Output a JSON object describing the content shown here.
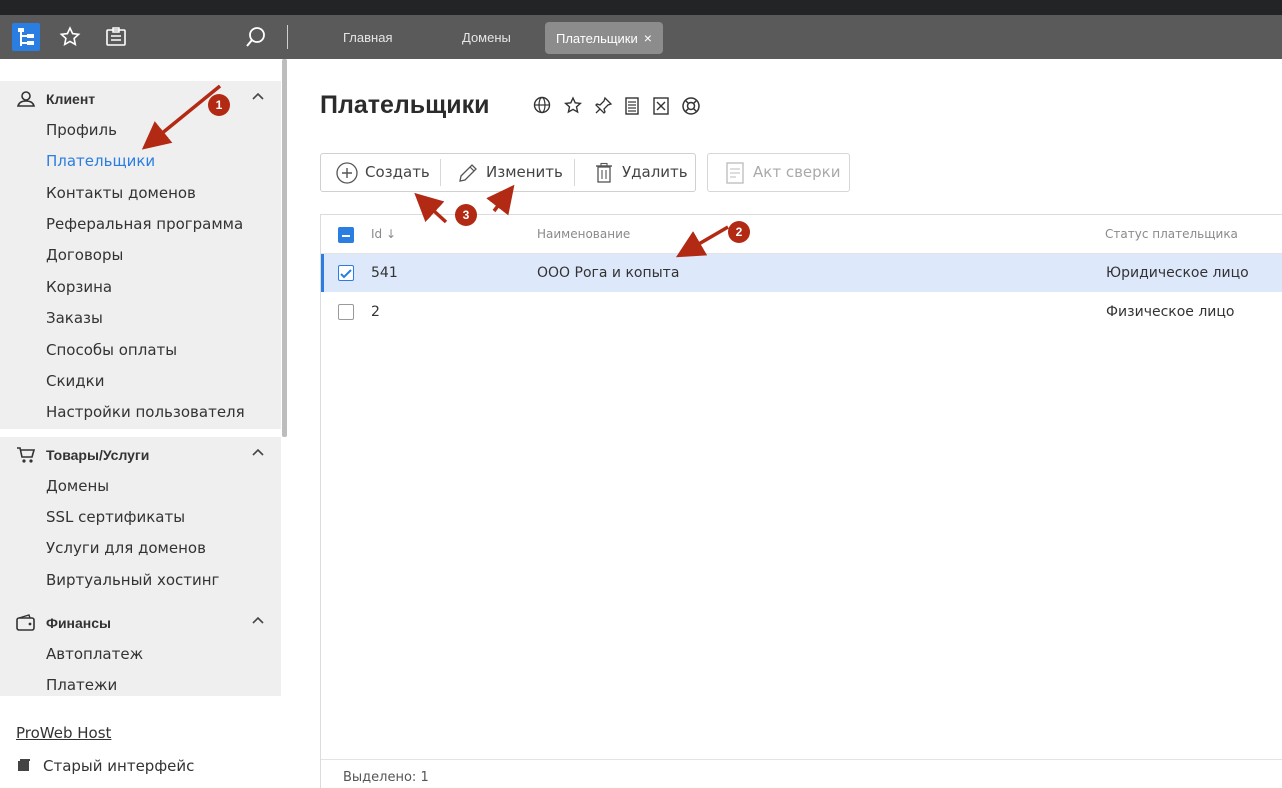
{
  "topbar": {
    "tabs": [
      {
        "label": "Главная"
      },
      {
        "label": "Домены"
      },
      {
        "label": "Плательщики",
        "close": "×"
      }
    ]
  },
  "sidebar": {
    "groups": [
      {
        "title": "Клиент",
        "icon": "user-icon",
        "items": [
          "Профиль",
          "Плательщики",
          "Контакты доменов",
          "Реферальная программа",
          "Договоры",
          "Корзина",
          "Заказы",
          "Способы оплаты",
          "Скидки",
          "Настройки пользователя"
        ],
        "active": "Плательщики"
      },
      {
        "title": "Товары/Услуги",
        "icon": "cart-icon",
        "items": [
          "Домены",
          "SSL сертификаты",
          "Услуги для доменов",
          "Виртуальный хостинг"
        ]
      },
      {
        "title": "Финансы",
        "icon": "wallet-icon",
        "items": [
          "Автоплатеж",
          "Платежи"
        ]
      }
    ],
    "bottom_links": [
      "ProWeb Host",
      "Старый интерфейс"
    ]
  },
  "main": {
    "title": "Плательщики",
    "toolbar": {
      "create": "Создать",
      "edit": "Изменить",
      "delete": "Удалить",
      "reconciliation": "Акт сверки"
    },
    "table": {
      "columns": [
        "Id",
        "Наименование",
        "Статус плательщика"
      ],
      "sort_indicator": "↓",
      "rows": [
        {
          "id": "541",
          "name": "ООО Рога и копыта",
          "status": "Юридическое лицо",
          "selected": true
        },
        {
          "id": "2",
          "name": "",
          "status": "Физическое лицо",
          "selected": false
        }
      ],
      "footer": "Выделено: 1"
    }
  },
  "annotations": {
    "badges": [
      "1",
      "2",
      "3"
    ],
    "color": "#b32a14"
  },
  "colors": {
    "accent": "#2a7de1",
    "topbar": "#5a5a5a",
    "selected_row": "#dde9fb"
  }
}
